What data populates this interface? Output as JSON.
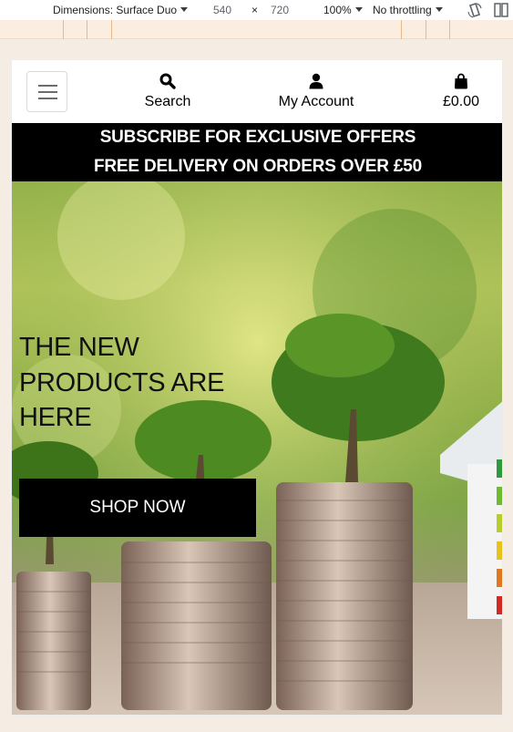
{
  "devtools": {
    "device_label": "Dimensions: Surface Duo",
    "width_value": "540",
    "times_sign": "×",
    "height_value": "720",
    "zoom_label": "100%",
    "throttle_label": "No throttling",
    "icons": [
      "rotate-icon",
      "dual-screen-icon"
    ]
  },
  "header": {
    "menu_toggle": "hamburger-icon",
    "search_label": "Search",
    "account_label": "My Account",
    "cart_total": "£0.00",
    "icons": [
      "search-icon",
      "user-icon",
      "shopping-bag-icon"
    ]
  },
  "banner": {
    "line1": "SUBSCRIBE FOR EXCLUSIVE OFFERS",
    "line2": "FREE DELIVERY ON ORDERS OVER £50"
  },
  "hero": {
    "title": "THE NEW PRODUCTS ARE HERE",
    "button_label": "SHOP NOW"
  },
  "colors": {
    "banner_bg": "#000000",
    "banner_text": "#ffffff",
    "page_bg": "#f5ece3"
  }
}
